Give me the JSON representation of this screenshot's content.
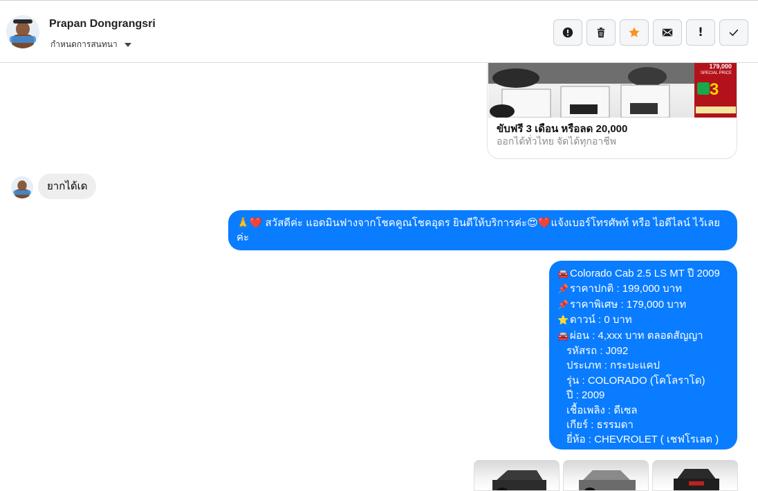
{
  "header": {
    "contact_name": "Prapan Dongrangsri",
    "assign_label": "กำหนดการสนทนา",
    "actions": [
      {
        "name": "report-button",
        "icon": "alert-circle-icon"
      },
      {
        "name": "delete-button",
        "icon": "trash-icon"
      },
      {
        "name": "star-button",
        "icon": "star-icon",
        "color": "#f7931e"
      },
      {
        "name": "email-button",
        "icon": "envelope-icon"
      },
      {
        "name": "mark-important-button",
        "icon": "exclamation-icon",
        "glyph": "!"
      },
      {
        "name": "mark-done-button",
        "icon": "check-icon"
      }
    ]
  },
  "attachment": {
    "title": "ขับฟรี 3 เดือน หรือลด 20,000",
    "subtitle": "ออกได้ทั่วไทย จัดได้ทุกอาชีพ",
    "promo_price": "179,000",
    "promo_label": "SPECIAL PRICE",
    "promo_big": "3"
  },
  "messages": {
    "received_1": "ยากได้เด",
    "sent_1": {
      "leading_icons": "🙏❤️",
      "text": " สวัสดีค่ะ แอดมินฟางจากโชคคูณโชคอุดร ยินดีให้บริการค่ะ😍❤️แจ้งเบอร์โทรศัพท์ หรือ ไอดีไลน์  ไว้เลยค่ะ"
    },
    "sent_2": [
      {
        "icon": "🚘",
        "text": "Colorado Cab 2.5 LS MT ปี 2009"
      },
      {
        "icon": "📌",
        "text": "ราคาปกติ : 199,000 บาท"
      },
      {
        "icon": "📌",
        "text": "ราคาพิเศษ : 179,000 บาท"
      },
      {
        "icon": "⭐",
        "text": "ดาวน์ : 0 บาท"
      },
      {
        "icon": "🚘",
        "text": "ผ่อน : 4,xxx บาท ตลอดสัญญา"
      },
      {
        "icon": "",
        "text": "รหัสรถ : J092"
      },
      {
        "icon": "",
        "text": "ประเภท : กระบะแคป"
      },
      {
        "icon": "",
        "text": "รุ่น : COLORADO (โคโลราโด)"
      },
      {
        "icon": "",
        "text": "ปี : 2009"
      },
      {
        "icon": "",
        "text": "เชื้อเพลิง : ดีเซล"
      },
      {
        "icon": "",
        "text": "เกียร์ : ธรรมดา"
      },
      {
        "icon": "",
        "text": "ยี่ห้อ : CHEVROLET ( เชฟโรเลต )"
      }
    ]
  },
  "colors": {
    "sent_bubble": "#0a7cff",
    "received_bubble": "#eeeeee"
  }
}
